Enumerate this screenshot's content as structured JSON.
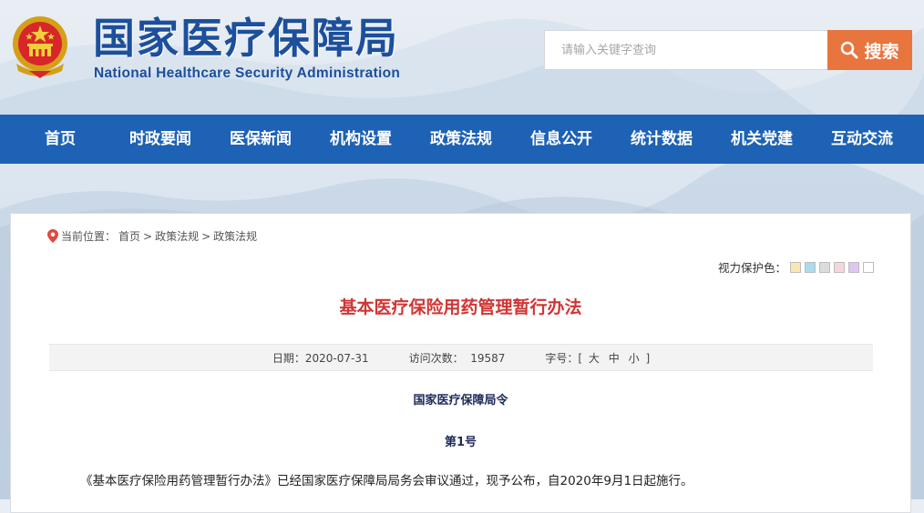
{
  "header": {
    "logo_cn": "国家医疗保障局",
    "logo_en": "National Healthcare Security Administration",
    "search_placeholder": "请输入关键字查询",
    "search_button": "搜索"
  },
  "nav": {
    "items": [
      "首页",
      "时政要闻",
      "医保新闻",
      "机构设置",
      "政策法规",
      "信息公开",
      "统计数据",
      "机关党建",
      "互动交流"
    ]
  },
  "breadcrumb": {
    "prefix": "当前位置：",
    "items": [
      "首页",
      "政策法规",
      "政策法规"
    ],
    "separator": ">"
  },
  "eye_care": {
    "label": "视力保护色：",
    "colors": [
      "#f8e7b0",
      "#a9dcef",
      "#dcdcdc",
      "#f6d6dd",
      "#dcc8f0",
      "#ffffff"
    ]
  },
  "article": {
    "title": "基本医疗保险用药管理暂行办法",
    "meta": {
      "date": "日期：2020-07-31",
      "visits": "访问次数：  19587",
      "font_size_label": "字号：[",
      "sizes": [
        "大",
        "中",
        "小"
      ],
      "font_size_end": "]"
    },
    "issuer": "国家医疗保障局令",
    "order_no": "第1号",
    "body": "《基本医疗保险用药管理暂行办法》已经国家医疗保障局局务会审议通过，现予公布，自2020年9月1日起施行。"
  },
  "colors": {
    "nav_bg": "#1d62b4",
    "search_btn": "#e8743e",
    "title_red": "#d03535",
    "logo_blue": "#1c4f9c"
  }
}
